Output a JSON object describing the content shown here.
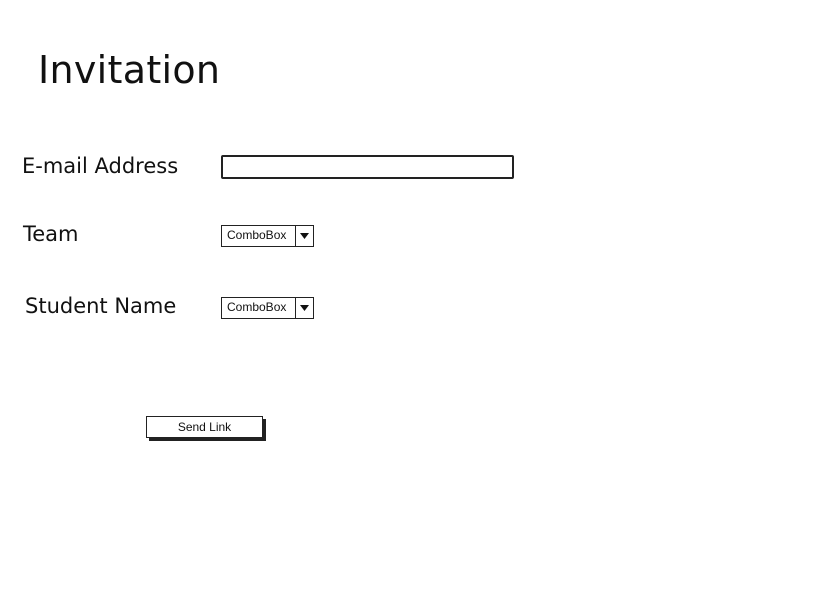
{
  "header": {
    "title": "Invitation"
  },
  "form": {
    "email": {
      "label": "E-mail Address",
      "value": ""
    },
    "team": {
      "label": "Team",
      "value": "ComboBox",
      "icon": "chevron-down-icon"
    },
    "student": {
      "label": "Student Name",
      "value": "ComboBox",
      "icon": "chevron-down-icon"
    },
    "submit": {
      "label": "Send Link"
    }
  }
}
